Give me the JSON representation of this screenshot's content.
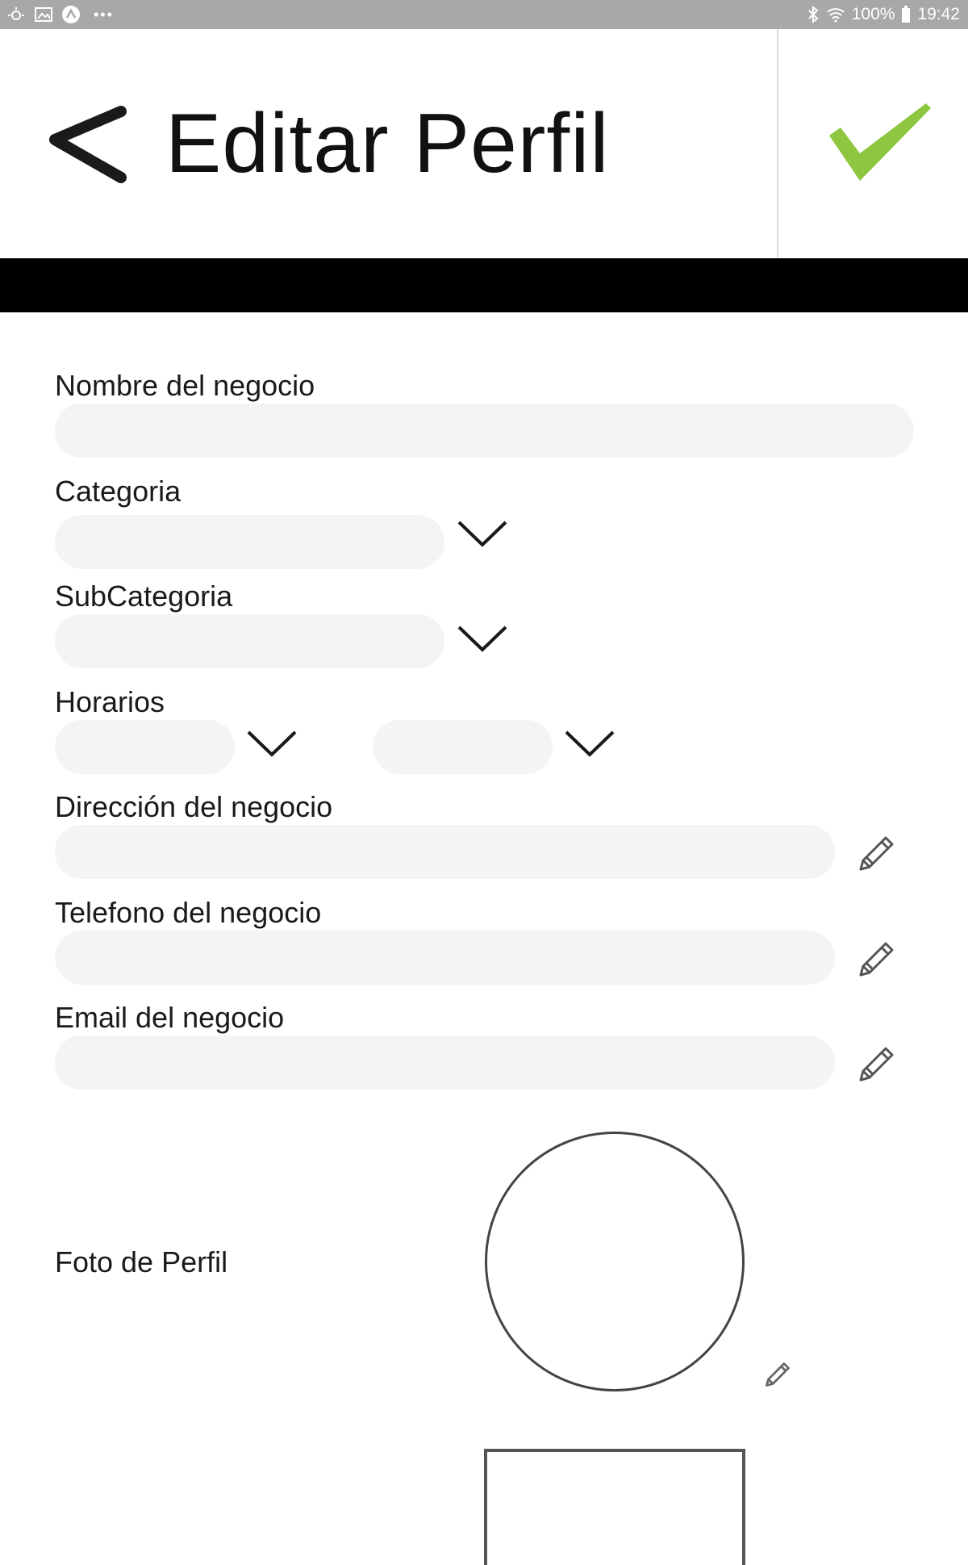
{
  "status_bar": {
    "battery": "100%",
    "time": "19:42",
    "more": "•••",
    "icons": [
      "notification-icon",
      "gallery-icon",
      "app-icon",
      "bluetooth-icon",
      "wifi-icon",
      "battery-icon"
    ]
  },
  "header": {
    "title": "Editar Perfil",
    "back_icon": "chevron-left-icon",
    "save_icon": "checkmark-icon",
    "accent_color": "#8dc63f"
  },
  "form": {
    "business_name": {
      "label": "Nombre del negocio",
      "value": ""
    },
    "category": {
      "label": "Categoria",
      "value": ""
    },
    "subcategory": {
      "label": "SubCategoria",
      "value": ""
    },
    "hours": {
      "label": "Horarios",
      "open_value": "",
      "close_value": ""
    },
    "address": {
      "label": "Dirección del negocio",
      "value": ""
    },
    "phone": {
      "label": "Telefono del negocio",
      "value": ""
    },
    "email": {
      "label": "Email del negocio",
      "value": ""
    },
    "photo": {
      "label": "Foto de Perfil"
    }
  },
  "colors": {
    "field_bg": "#f3f4f6",
    "status_bar_bg": "#a8a8a8",
    "band": "#000000"
  }
}
